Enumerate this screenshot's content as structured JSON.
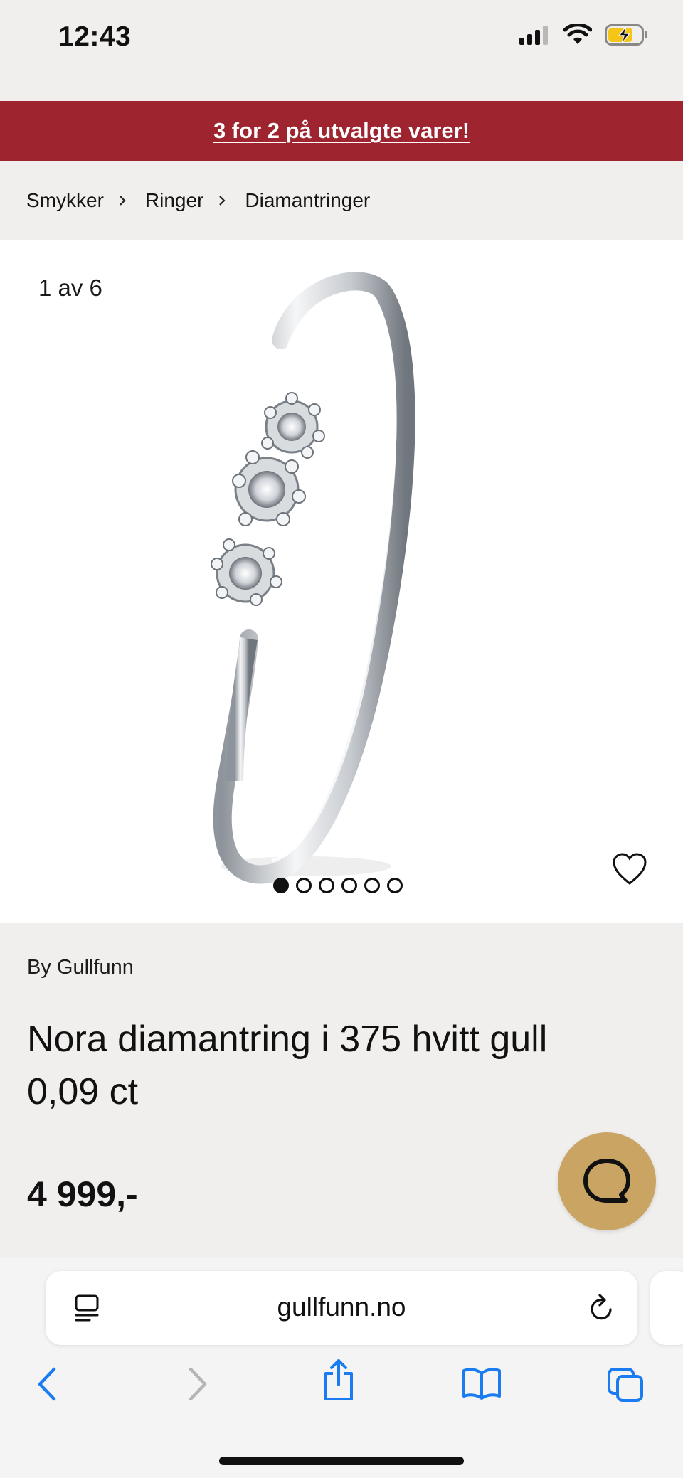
{
  "status_bar": {
    "time": "12:43"
  },
  "promo": {
    "text": "3 for 2 på utvalgte varer!"
  },
  "breadcrumb": {
    "items": [
      "Smykker",
      "Ringer",
      "Diamantringer"
    ]
  },
  "gallery": {
    "counter": "1 av 6",
    "total_images": 6,
    "active_index": 0
  },
  "product": {
    "brand": "By Gullfunn",
    "title": "Nora diamantring i 375 hvitt gull 0,09 ct",
    "price": "4 999,-"
  },
  "browser": {
    "url": "gullfunn.no"
  },
  "colors": {
    "promo_bg": "#9e2530",
    "chat_bg": "#c9a463",
    "accent_blue": "#1a7cf0",
    "page_bg": "#f0efed"
  }
}
